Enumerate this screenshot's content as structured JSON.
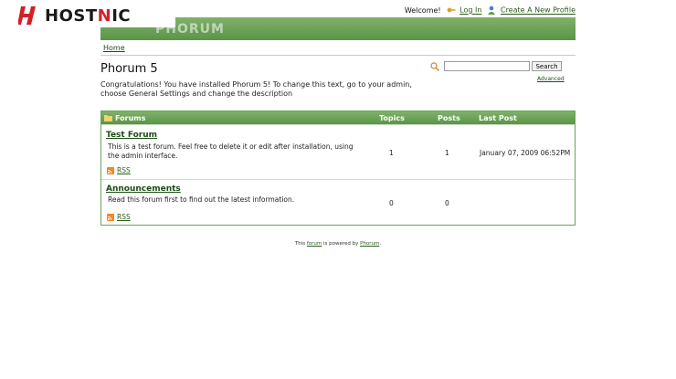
{
  "brand": {
    "name_part1": "HOST",
    "name_part2": "N",
    "name_part3": "IC"
  },
  "top": {
    "welcome": "Welcome!",
    "login": "Log In",
    "create_profile": "Create A New Profile"
  },
  "header": {
    "logo_text": "PHORUM"
  },
  "breadcrumb": {
    "home": "Home"
  },
  "page": {
    "title": "Phorum 5",
    "intro": "Congratulations! You have installed Phorum 5! To change this text, go to your admin, choose General Settings and change the description"
  },
  "search": {
    "placeholder": "",
    "button": "Search",
    "advanced": "Advanced"
  },
  "table": {
    "headers": {
      "forums": "Forums",
      "topics": "Topics",
      "posts": "Posts",
      "last_post": "Last Post"
    },
    "rows": [
      {
        "name": "Test Forum",
        "description": "This is a test forum. Feel free to delete it or edit after installation, using the admin interface.",
        "rss": "RSS",
        "topics": "1",
        "posts": "1",
        "last_post": "January 07, 2009 06:52PM"
      },
      {
        "name": "Announcements",
        "description": "Read this forum first to find out the latest information.",
        "rss": "RSS",
        "topics": "0",
        "posts": "0",
        "last_post": ""
      }
    ]
  },
  "footer": {
    "before": "This",
    "link1": "forum",
    "middle": "is powered by",
    "link2": "Phorum",
    "after": "."
  },
  "colors": {
    "green_header": "#6aa25a",
    "link_green": "#1a4d13",
    "brand_red": "#d32027"
  },
  "icons": {
    "brand": "hostnic-logo-icon",
    "login": "key-icon",
    "profile": "user-icon",
    "search": "magnifier-icon",
    "forums": "folder-icon",
    "rss": "rss-icon"
  }
}
